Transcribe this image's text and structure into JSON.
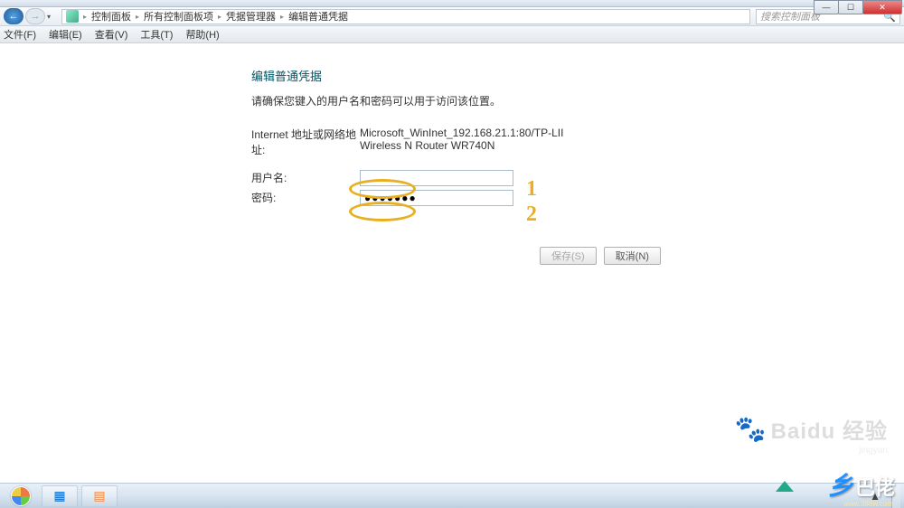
{
  "titlebar": {
    "minimize": "—",
    "maximize": "☐",
    "close": "✕"
  },
  "nav": {
    "back": "←",
    "fwd": "→",
    "dd": "▾",
    "crumbs": [
      "控制面板",
      "所有控制面板项",
      "凭据管理器",
      "编辑普通凭据"
    ],
    "sep": "▸",
    "search_placeholder": "搜索控制面板",
    "search_icon": "🔍"
  },
  "menu": {
    "file": "文件(F)",
    "edit": "编辑(E)",
    "view": "查看(V)",
    "tools": "工具(T)",
    "help": "帮助(H)"
  },
  "form": {
    "heading": "编辑普通凭据",
    "subtext": "请确保您键入的用户名和密码可以用于访问该位置。",
    "addr_label": "Internet 地址或网络地址:",
    "addr_value_l1": "Microsoft_WinInet_192.168.21.1:80/TP-LII",
    "addr_value_l2": "Wireless N Router WR740N",
    "user_label": "用户名:",
    "user_value": "",
    "pass_label": "密码:",
    "pass_value": "●●●●●●●",
    "save_btn": "保存(S)",
    "cancel_btn": "取消(N)",
    "ann1": "1",
    "ann2": "2"
  },
  "watermark": {
    "text": "Baidu 经验",
    "paw": "🐾",
    "url": "jingyan"
  },
  "taskbar": {
    "b1": "▦",
    "b2": "▤",
    "flag": "▲"
  },
  "logo": {
    "l1": "乡",
    "l2": "巴佬",
    "url": "www.386w.com"
  }
}
